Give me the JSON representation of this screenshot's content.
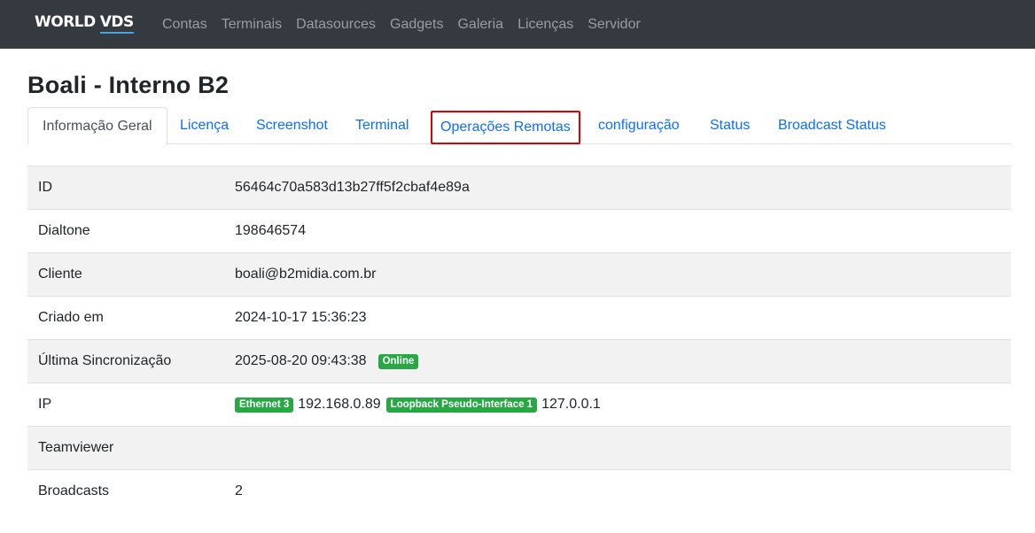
{
  "navbar": {
    "brand_part1": "WORLD",
    "brand_part2": "VDS",
    "links": [
      "Contas",
      "Terminais",
      "Datasources",
      "Gadgets",
      "Galeria",
      "Licenças",
      "Servidor"
    ]
  },
  "page": {
    "title": "Boali - Interno B2"
  },
  "tabs": [
    {
      "label": "Informação Geral",
      "active": true
    },
    {
      "label": "Licença"
    },
    {
      "label": "Screenshot"
    },
    {
      "label": "Terminal"
    },
    {
      "label": "Operações Remotas",
      "highlighted": true
    },
    {
      "label": "configuração"
    },
    {
      "label": "Status"
    },
    {
      "label": "Broadcast Status"
    }
  ],
  "info": {
    "id": {
      "label": "ID",
      "value": "56464c70a583d13b27ff5f2cbaf4e89a"
    },
    "dialtone": {
      "label": "Dialtone",
      "value": "198646574"
    },
    "cliente": {
      "label": "Cliente",
      "value": "boali@b2midia.com.br"
    },
    "criado": {
      "label": "Criado em",
      "value": "2024-10-17 15:36:23"
    },
    "sync": {
      "label": "Última Sincronização",
      "value": "2025-08-20 09:43:38",
      "badge": "Online"
    },
    "ip": {
      "label": "IP",
      "interfaces": [
        {
          "badge": "Ethernet 3",
          "address": "192.168.0.89"
        },
        {
          "badge": "Loopback Pseudo-Interface 1",
          "address": "127.0.0.1"
        }
      ]
    },
    "teamviewer": {
      "label": "Teamviewer",
      "value": ""
    },
    "broadcasts": {
      "label": "Broadcasts",
      "value": "2"
    }
  },
  "colors": {
    "navbar_bg": "#343a40",
    "link": "#0d6efd",
    "badge_success": "#28a745",
    "highlight_border": "#e00000"
  }
}
